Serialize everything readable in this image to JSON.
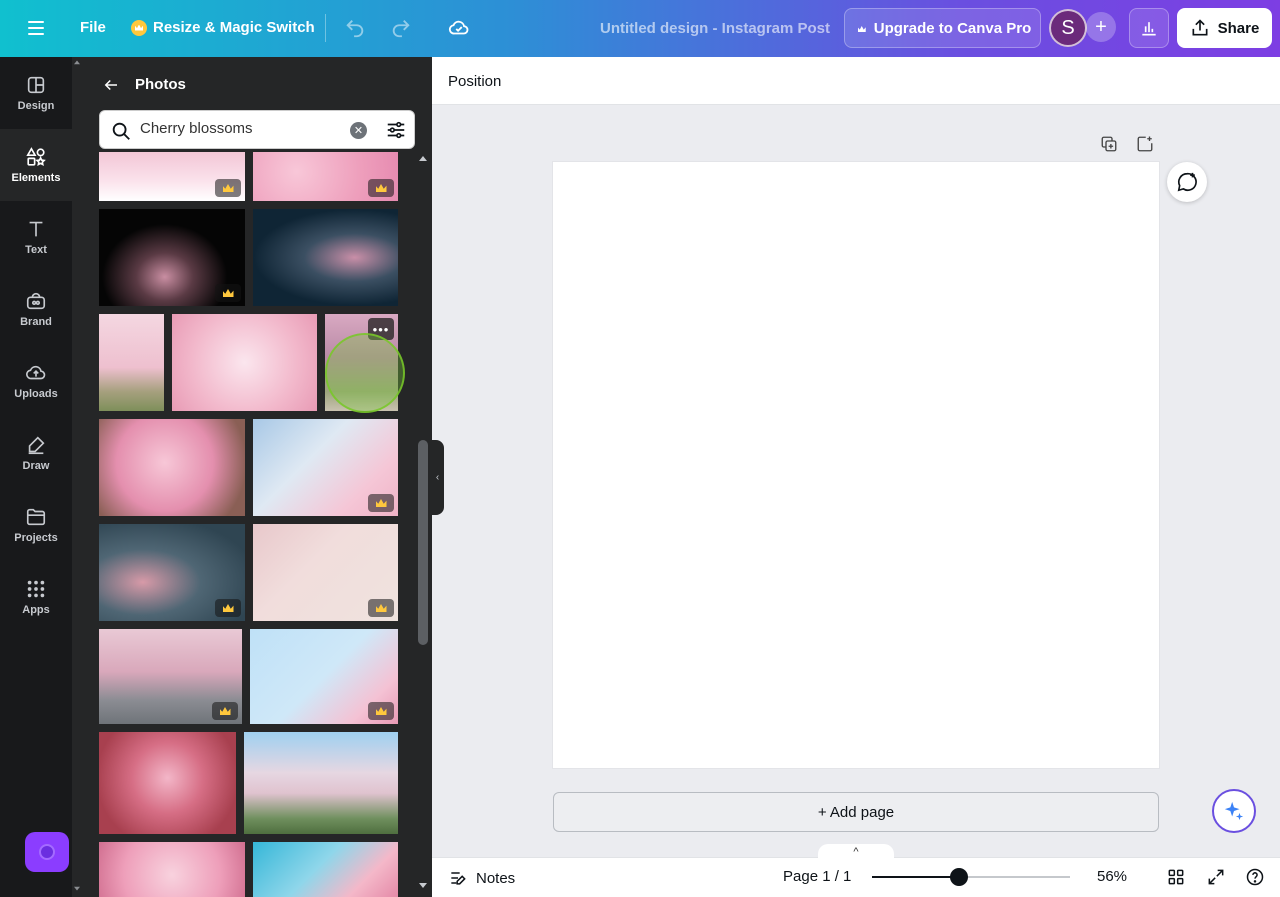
{
  "topbar": {
    "file_label": "File",
    "resize_label": "Resize & Magic Switch",
    "doc_title": "Untitled design - Instagram Post",
    "upgrade_label": "Upgrade to Canva Pro",
    "avatar_initial": "S",
    "share_label": "Share"
  },
  "rail": {
    "items": [
      {
        "label": "Design",
        "icon": "design-icon"
      },
      {
        "label": "Elements",
        "icon": "elements-icon"
      },
      {
        "label": "Text",
        "icon": "text-icon"
      },
      {
        "label": "Brand",
        "icon": "brand-icon"
      },
      {
        "label": "Uploads",
        "icon": "uploads-icon"
      },
      {
        "label": "Draw",
        "icon": "draw-icon"
      },
      {
        "label": "Projects",
        "icon": "projects-icon"
      },
      {
        "label": "Apps",
        "icon": "apps-icon"
      }
    ],
    "active": "Elements"
  },
  "panel": {
    "title": "Photos",
    "search_value": "Cherry blossoms"
  },
  "canvas": {
    "toolbar_label": "Position",
    "add_page_label": "+ Add page"
  },
  "bottombar": {
    "notes_label": "Notes",
    "page_indicator": "Page 1 / 1",
    "zoom_label": "56%",
    "zoom_level": 0.44
  },
  "colors": {
    "accent": "#8b3dff",
    "topbar_start": "#10c0cf",
    "topbar_end": "#7d3ee3",
    "panel_bg": "#252627",
    "rail_bg": "#18191b"
  }
}
